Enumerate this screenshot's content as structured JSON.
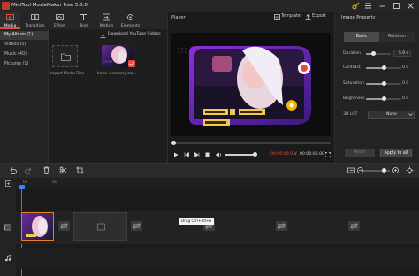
{
  "app": {
    "title": "MiniTool MovieMaker Free 5.3.0"
  },
  "toolbar": {
    "tools": [
      {
        "label": "Media",
        "icon": "media-icon"
      },
      {
        "label": "Transition",
        "icon": "transition-icon"
      },
      {
        "label": "Effect",
        "icon": "effect-icon"
      },
      {
        "label": "Text",
        "icon": "text-icon"
      },
      {
        "label": "Motion",
        "icon": "motion-icon"
      },
      {
        "label": "Elements",
        "icon": "elements-icon"
      }
    ]
  },
  "categories": [
    "My Album (1)",
    "Videos (0)",
    "Music (40)",
    "Pictures (1)"
  ],
  "media": {
    "download_link": "Download YouTube Videos",
    "import_label": "Import Media Files",
    "thumb_label": "home-summary-tra..."
  },
  "player": {
    "label": "Player",
    "template": "Template",
    "export": "Export",
    "time_current": "00:00:00.00",
    "time_sep": "/",
    "time_total": "00:00:05.00",
    "progress": 0.0,
    "volume": 0.9
  },
  "properties": {
    "title": "Image Property",
    "tabs": [
      "Basic",
      "Rotation"
    ],
    "duration_label": "Duration",
    "duration_value": "5.0 s",
    "contrast_label": "Contrast",
    "contrast_value": "0.0",
    "saturation_label": "Saturation",
    "saturation_value": "0.0",
    "brightness_label": "Brightness",
    "brightness_value": "0.0",
    "lut_label": "3D LUT",
    "lut_value": "None",
    "reset": "Reset",
    "apply": "Apply to all"
  },
  "timeline": {
    "ticks": [
      "0s",
      "5s"
    ],
    "tooltip": "Drag Ctrl+Alt+a"
  },
  "colors": {
    "accent": "#e74c3c",
    "playhead": "#3d7dff",
    "clip_border": "#e67e22"
  }
}
